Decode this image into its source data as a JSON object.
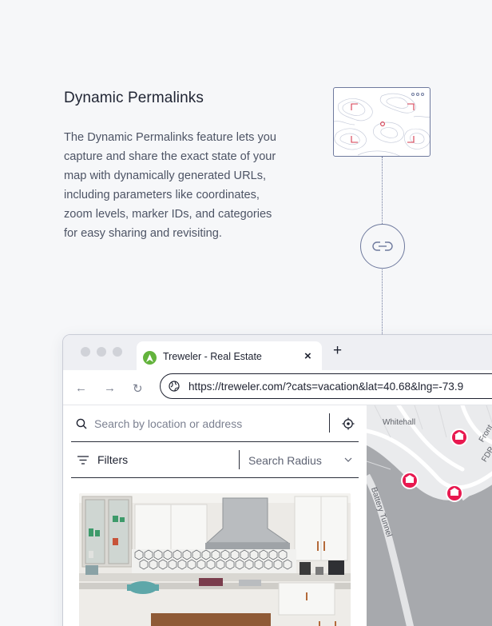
{
  "feature": {
    "title": "Dynamic Permalinks",
    "description": "The Dynamic Permalinks feature lets you capture and share the exact state of your map with dynamically generated URLs, including parameters like coordinates, zoom levels, marker IDs, and categories for easy sharing and revisiting."
  },
  "icons": {
    "link": "link-icon",
    "favicon": "treweler-logo-icon",
    "globe": "globe-icon",
    "search": "search-icon",
    "locate": "crosshair-icon",
    "filter": "filter-lines-icon",
    "chevron": "chevron-down-icon",
    "marker": "house-marker-icon"
  },
  "browser": {
    "tab_title": "Treweler - Real Estate",
    "tab_close": "×",
    "new_tab": "+",
    "back": "←",
    "forward": "→",
    "reload": "↻",
    "url": "https://treweler.com/?cats=vacation&lat=40.68&lng=-73.9"
  },
  "panel": {
    "search_placeholder": "Search by location or address",
    "filters_label": "Filters",
    "radius_label": "Search Radius"
  },
  "map": {
    "labels": [
      "Whitehall",
      "Front",
      "FDR",
      "Battery Tunnel"
    ],
    "marker_color": "#e8184f"
  },
  "colors": {
    "accent": "#e8184f",
    "brand_green": "#63b33c",
    "line": "#6f7a9e"
  }
}
